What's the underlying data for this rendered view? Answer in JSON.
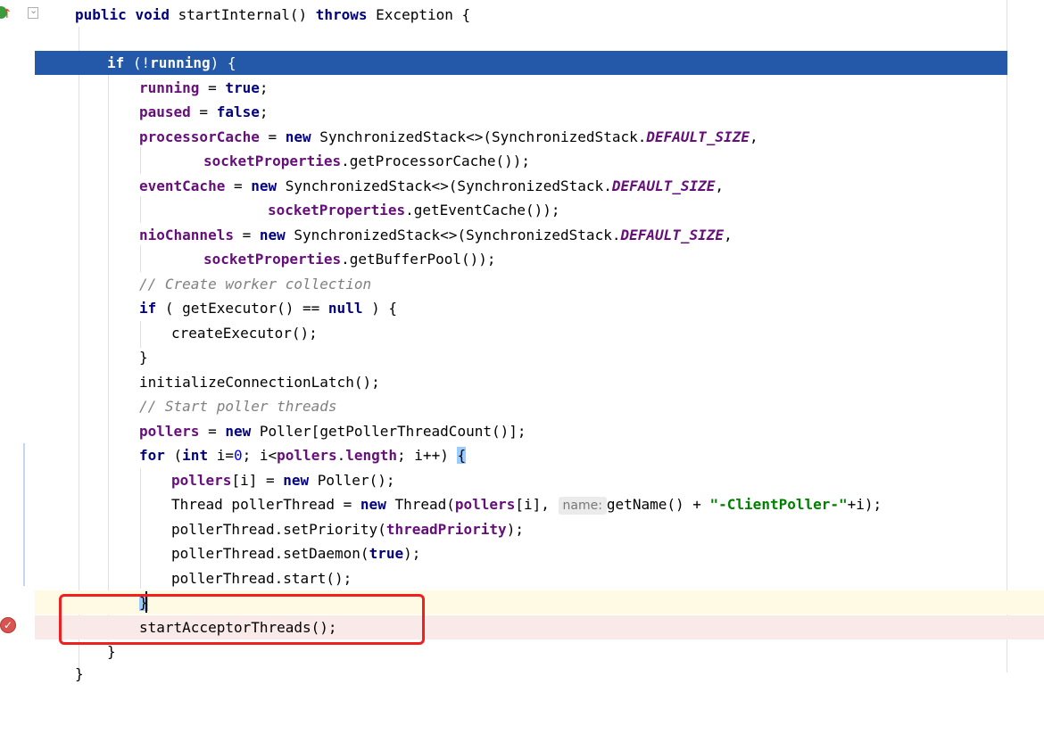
{
  "editor": {
    "lines": {
      "l1": {
        "kw1": "public",
        "kw2": "void",
        "t1": " startInternal() ",
        "kw3": "throws",
        "t2": " Exception {"
      },
      "l3": {
        "kw1": "if",
        "t1": " (!",
        "kw2": "running",
        "t2": ") {"
      },
      "l4": {
        "fld": "running",
        "t1": " = ",
        "kw": "true",
        "t2": ";"
      },
      "l5": {
        "fld": "paused",
        "t1": " = ",
        "kw": "false",
        "t2": ";"
      },
      "l6": {
        "fld": "processorCache",
        "t1": " = ",
        "kw": "new",
        "t2": " SynchronizedStack<>(SynchronizedStack.",
        "cst": "DEFAULT_SIZE",
        "t3": ","
      },
      "l7": {
        "fld": "socketProperties",
        "t1": ".getProcessorCache());"
      },
      "l8": {
        "fld": "eventCache",
        "t1": " = ",
        "kw": "new",
        "t2": " SynchronizedStack<>(SynchronizedStack.",
        "cst": "DEFAULT_SIZE",
        "t3": ","
      },
      "l9": {
        "fld": "socketProperties",
        "t1": ".getEventCache());"
      },
      "l10": {
        "fld": "nioChannels",
        "t1": " = ",
        "kw": "new",
        "t2": " SynchronizedStack<>(SynchronizedStack.",
        "cst": "DEFAULT_SIZE",
        "t3": ","
      },
      "l11": {
        "fld": "socketProperties",
        "t1": ".getBufferPool());"
      },
      "l12": {
        "cmt": "// Create worker collection"
      },
      "l13": {
        "kw1": "if",
        "t1": " ( getExecutor() == ",
        "kw2": "null",
        "t2": " ) {"
      },
      "l14": {
        "t1": "createExecutor();"
      },
      "l15": {
        "t1": "}"
      },
      "l16": {
        "t1": "initializeConnectionLatch();"
      },
      "l17": {
        "cmt": "// Start poller threads"
      },
      "l18": {
        "fld1": "pollers",
        "t1": " = ",
        "kw": "new",
        "t2": " Poller[getPollerThreadCount()];"
      },
      "l19": {
        "kw1": "for",
        "t1": " (",
        "kw2": "int",
        "t2": " i=",
        "num": "0",
        "t3": "; i<",
        "fld1": "pollers",
        "t4": ".",
        "fld2": "length",
        "t5": "; i++) ",
        "brace": "{"
      },
      "l20": {
        "fld": "pollers",
        "t1": "[i] = ",
        "kw": "new",
        "t2": " Poller();"
      },
      "l21": {
        "t1": "Thread pollerThread = ",
        "kw": "new",
        "t2": " Thread(",
        "fld": "pollers",
        "t3": "[i], ",
        "hint": "name:",
        "t4": "getName() + ",
        "str": "\"-ClientPoller-\"",
        "t5": "+i);"
      },
      "l22": {
        "t1": "pollerThread.setPriority(",
        "fld": "threadPriority",
        "t2": ");"
      },
      "l23": {
        "t1": "pollerThread.setDaemon(",
        "kw": "true",
        "t2": ");"
      },
      "l24": {
        "t1": "pollerThread.start();"
      },
      "l25": {
        "t1": "}"
      },
      "l26": {
        "t1": "startAcceptorThreads();"
      },
      "l27": {
        "t1": "}"
      },
      "l28": {
        "t1": "}"
      }
    },
    "colors": {
      "keyword": "#000080",
      "field": "#660e7a",
      "comment": "#808080",
      "string": "#008000",
      "number": "#0000ff",
      "current_line_highlight": "#2458a8",
      "breakpoint_line": "#fae9e9",
      "callout_border": "#f02020"
    },
    "gutter_icons": [
      "override-method-icon",
      "fold-icon",
      "breakpoint-icon"
    ]
  }
}
